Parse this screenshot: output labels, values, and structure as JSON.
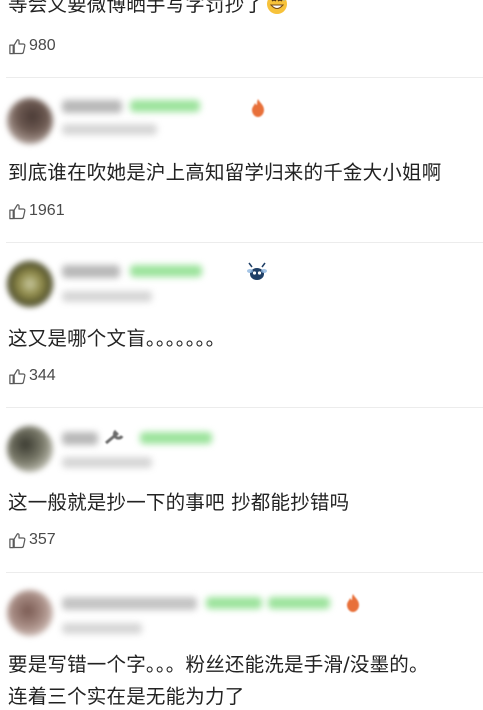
{
  "comments": [
    {
      "text": "等会又要微博晒手写字罚抄了",
      "emoji": "grinning-sweat-emoji",
      "likes": "980"
    },
    {
      "text": "到底谁在吹她是沪上高知留学归来的千金大小姐啊",
      "likes": "1961"
    },
    {
      "text": "这又是哪个文盲。。。。。。。",
      "likes": "344"
    },
    {
      "text": "这一般就是抄一下的事吧 抄都能抄错吗",
      "likes": "357"
    },
    {
      "text": "要是写错一个字。。。粉丝还能洗是手滑/没墨的。",
      "text_line2": "连着三个实在是无能为力了"
    }
  ],
  "colors": {
    "badge_green": "#9be39b",
    "badge_orange": "#e8703a",
    "divider": "#ececec",
    "like_gray": "#4a4a4a"
  },
  "icons": {
    "like": "thumbs-up-icon",
    "fire": "fire-badge-icon",
    "bee": "bee-badge-icon",
    "tool": "wrench-badge-icon"
  }
}
